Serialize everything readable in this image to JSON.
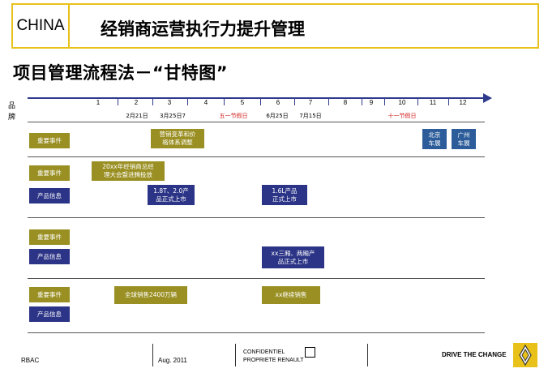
{
  "header": {
    "china_label": "CHINA",
    "title": "经销商运营执行力提升管理"
  },
  "subtitle": "项目管理流程法－“甘特图”",
  "axis": {
    "label": "品 牌",
    "months": [
      "1",
      "2",
      "3",
      "4",
      "5",
      "6",
      "7",
      "8",
      "9",
      "10",
      "11",
      "12"
    ]
  },
  "dates": [
    {
      "text": "2月21日",
      "red": false
    },
    {
      "text": "3月25日7",
      "red": false
    },
    {
      "text": "五一节假日",
      "red": true
    },
    {
      "text": "6月25日",
      "red": false
    },
    {
      "text": "7月15日",
      "red": false
    },
    {
      "text": "十一节假日",
      "red": true
    }
  ],
  "rows": {
    "r1": {
      "key_event": "重要事件",
      "task_a": "营销变革和价\n格体系调整",
      "beijing": "北京\n车展",
      "guangzhou": "广州\n车展"
    },
    "r2": {
      "key_event": "重要事件",
      "product_info": "产品信息",
      "dealer_meeting": "20xx年经销商总经\n理大会暨进腾投放",
      "launch_a": "1.8T、2.0产\n品正式上市",
      "launch_b": "1.6L产品\n正式上市"
    },
    "r3": {
      "key_event": "重要事件",
      "product_info": "产品信息",
      "launch_c": "xx三厢、两厢产\n品正式上市"
    },
    "r4": {
      "key_event": "重要事件",
      "product_info": "产品信息",
      "sales_a": "全球销售2400万辆",
      "sales_b": "xx继续销售"
    }
  },
  "footer": {
    "org": "RBAC",
    "date": "Aug. 2011",
    "confidential": "CONFIDENTIEL\nPROPRIETE RENAULT",
    "slogan": "DRIVE THE CHANGE"
  },
  "colors": {
    "accent": "#e8c21a",
    "olive": "#9a8f22",
    "navy": "#2b3486",
    "holiday_red": "#d32020"
  },
  "logo_icon": "renault-diamond-icon"
}
